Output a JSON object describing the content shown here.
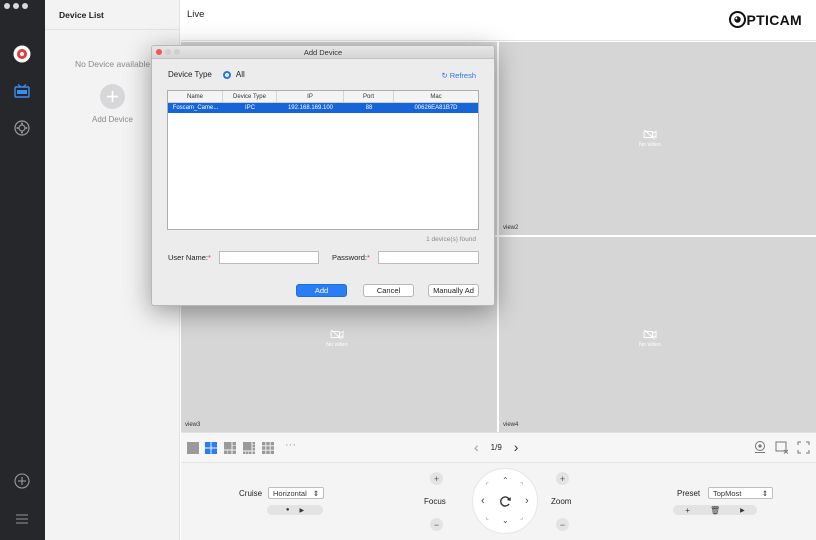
{
  "device_list": {
    "title": "Device List",
    "empty_text": "No Device available",
    "add_label": "Add Device"
  },
  "main": {
    "title": "Live",
    "logo_text": "PTICAM"
  },
  "views": [
    {
      "label": "view2",
      "status": "No video"
    },
    {
      "label": "view3",
      "status": "No video"
    },
    {
      "label": "view4",
      "status": "No video"
    }
  ],
  "toolbar": {
    "more": "···",
    "page_indicator": "1/9"
  },
  "ptz": {
    "cruise_label": "Cruise",
    "cruise_value": "Horizontal",
    "focus_label": "Focus",
    "zoom_label": "Zoom",
    "preset_label": "Preset",
    "preset_value": "TopMost"
  },
  "dialog": {
    "title": "Add Device",
    "device_type_label": "Device Type",
    "device_type_option": "All",
    "refresh_label": "Refresh",
    "columns": [
      "Name",
      "Device Type",
      "IP",
      "Port",
      "Mac"
    ],
    "rows": [
      [
        "Foscam_Came...",
        "IPC",
        "192.168.169.100",
        "88",
        "00626EA81B7D"
      ]
    ],
    "found_text": "1 device(s) found",
    "username_label": "User Name:",
    "password_label": "Password:",
    "required_mark": "*",
    "username_value": "",
    "password_value": "",
    "add_button": "Add",
    "cancel_button": "Cancel",
    "manual_button": "Manually Ad"
  },
  "colors": {
    "accent": "#2a7ef5",
    "selection": "#1565d8",
    "rail": "#26272b",
    "video_bg": "#d6d6d6",
    "required": "#e0302e"
  }
}
